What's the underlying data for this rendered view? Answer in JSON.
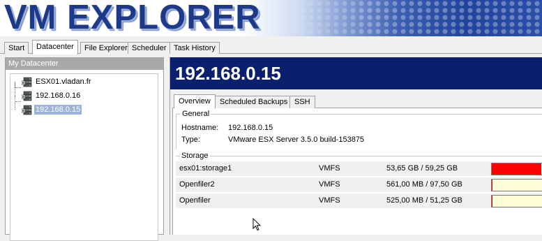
{
  "banner": {
    "title": "VM EXPLORER"
  },
  "main_tabs": [
    {
      "label": "Start"
    },
    {
      "label": "Datacenter",
      "active": true
    },
    {
      "label": "File Explorer"
    },
    {
      "label": "Scheduler"
    },
    {
      "label": "Task History"
    }
  ],
  "left_panel": {
    "header": "My Datacenter",
    "tree": [
      {
        "label": "ESX01.vladan.fr",
        "icon": "server-icon"
      },
      {
        "label": "192.168.0.16",
        "icon": "server-icon"
      },
      {
        "label": "192.168.0.15",
        "icon": "server-icon",
        "selected": true
      }
    ]
  },
  "right_panel": {
    "host_title": "192.168.0.15",
    "sub_tabs": [
      {
        "label": "Overview",
        "active": true
      },
      {
        "label": "Scheduled Backups"
      },
      {
        "label": "SSH"
      }
    ],
    "general": {
      "label": "General",
      "hostname_label": "Hostname:",
      "hostname_value": "192.168.0.15",
      "type_label": "Type:",
      "type_value": "VMware ESX Server 3.5.0 build-153875"
    },
    "storage": {
      "label": "Storage",
      "rows": [
        {
          "name": "esx01:storage1",
          "type": "VMFS",
          "usage": "53,65 GB / 59,25 GB",
          "fill_fraction": 0.905,
          "fill_color": "#ff0000"
        },
        {
          "name": "Openfiler2",
          "type": "VMFS",
          "usage": "561,00 MB / 97,50 GB",
          "fill_fraction": 0.006,
          "fill_color": "#ff0000"
        },
        {
          "name": "Openfiler",
          "type": "VMFS",
          "usage": "525,00 MB / 51,25 GB",
          "fill_fraction": 0.01,
          "fill_color": "#ff0000"
        }
      ]
    }
  },
  "colors": {
    "header_bg": "#0a1f6e",
    "banner_text": "#1d3a8a",
    "selection": "#9cb4d8",
    "bar_empty": "#fffed8",
    "bar_full": "#ff0000"
  }
}
